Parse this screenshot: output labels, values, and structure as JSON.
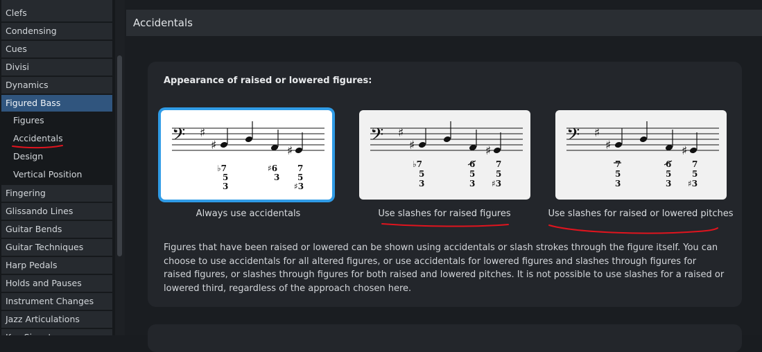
{
  "sidebar": {
    "items": [
      {
        "label": "Clefs"
      },
      {
        "label": "Condensing"
      },
      {
        "label": "Cues"
      },
      {
        "label": "Divisi"
      },
      {
        "label": "Dynamics"
      },
      {
        "label": "Figured Bass"
      },
      {
        "label": "Figures"
      },
      {
        "label": "Accidentals"
      },
      {
        "label": "Design"
      },
      {
        "label": "Vertical Position"
      },
      {
        "label": "Fingering"
      },
      {
        "label": "Glissando Lines"
      },
      {
        "label": "Guitar Bends"
      },
      {
        "label": "Guitar Techniques"
      },
      {
        "label": "Harp Pedals"
      },
      {
        "label": "Holds and Pauses"
      },
      {
        "label": "Instrument Changes"
      },
      {
        "label": "Jazz Articulations"
      },
      {
        "label": "Key Signatures"
      }
    ],
    "active_item": "Figured Bass",
    "selected_subitem": "Accidentals"
  },
  "main": {
    "section_title": "Accidentals",
    "option": {
      "heading": "Appearance of raised or lowered figures:",
      "choices": [
        {
          "label": "Always use accidentals",
          "selected": true
        },
        {
          "label": "Use slashes for raised figures",
          "selected": false
        },
        {
          "label": "Use slashes for raised or lowered pitches",
          "selected": false
        }
      ],
      "description": "Figures that have been raised or lowered can be shown using accidentals or slash strokes through the figure itself. You can choose to use accidentals for all altered figures, or use accidentals for lowered figures and slashes through figures for raised figures, or slashes through figures for both raised and lowered pitches. It is not possible to use slashes for a raised or lowered third, regardless of the approach chosen here."
    }
  },
  "colors": {
    "accent": "#2f9be6",
    "active_item": "#30557e",
    "annotation": "#e0141e"
  },
  "icons": [
    "bass-clef-icon",
    "sharp-icon",
    "flat-icon"
  ]
}
